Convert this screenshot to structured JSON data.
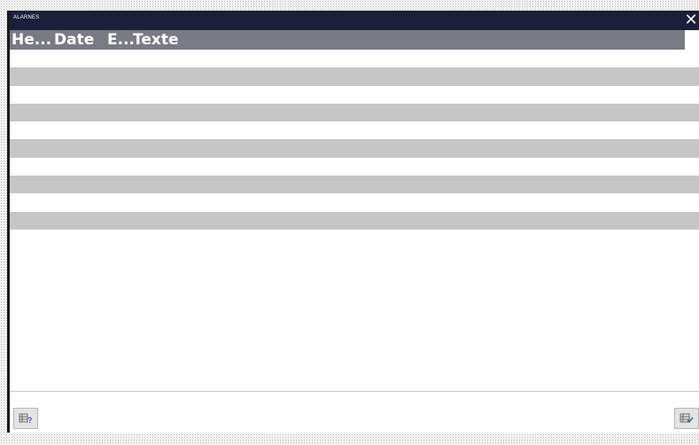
{
  "window": {
    "title": "ALARNES",
    "close_label": "✕"
  },
  "table": {
    "columns": [
      "He...",
      "Date",
      "E...",
      "Texte"
    ],
    "rows": [
      {
        "cells": [
          "",
          "",
          "",
          ""
        ],
        "shaded": false
      },
      {
        "cells": [
          "",
          "",
          "",
          ""
        ],
        "shaded": true
      },
      {
        "cells": [
          "",
          "",
          "",
          ""
        ],
        "shaded": false
      },
      {
        "cells": [
          "",
          "",
          "",
          ""
        ],
        "shaded": true
      },
      {
        "cells": [
          "",
          "",
          "",
          ""
        ],
        "shaded": false
      },
      {
        "cells": [
          "",
          "",
          "",
          ""
        ],
        "shaded": true
      },
      {
        "cells": [
          "",
          "",
          "",
          ""
        ],
        "shaded": false
      },
      {
        "cells": [
          "",
          "",
          "",
          ""
        ],
        "shaded": true
      },
      {
        "cells": [
          "",
          "",
          "",
          ""
        ],
        "shaded": false
      },
      {
        "cells": [
          "",
          "",
          "",
          ""
        ],
        "shaded": true
      }
    ]
  },
  "toolbar": {
    "left_icon": "table-help-icon",
    "right_icon": "table-acknowledge-icon"
  },
  "colors": {
    "titlebar": "#1b1f3a",
    "header": "#7a7a84",
    "row_shaded": "#c6c6c6"
  }
}
